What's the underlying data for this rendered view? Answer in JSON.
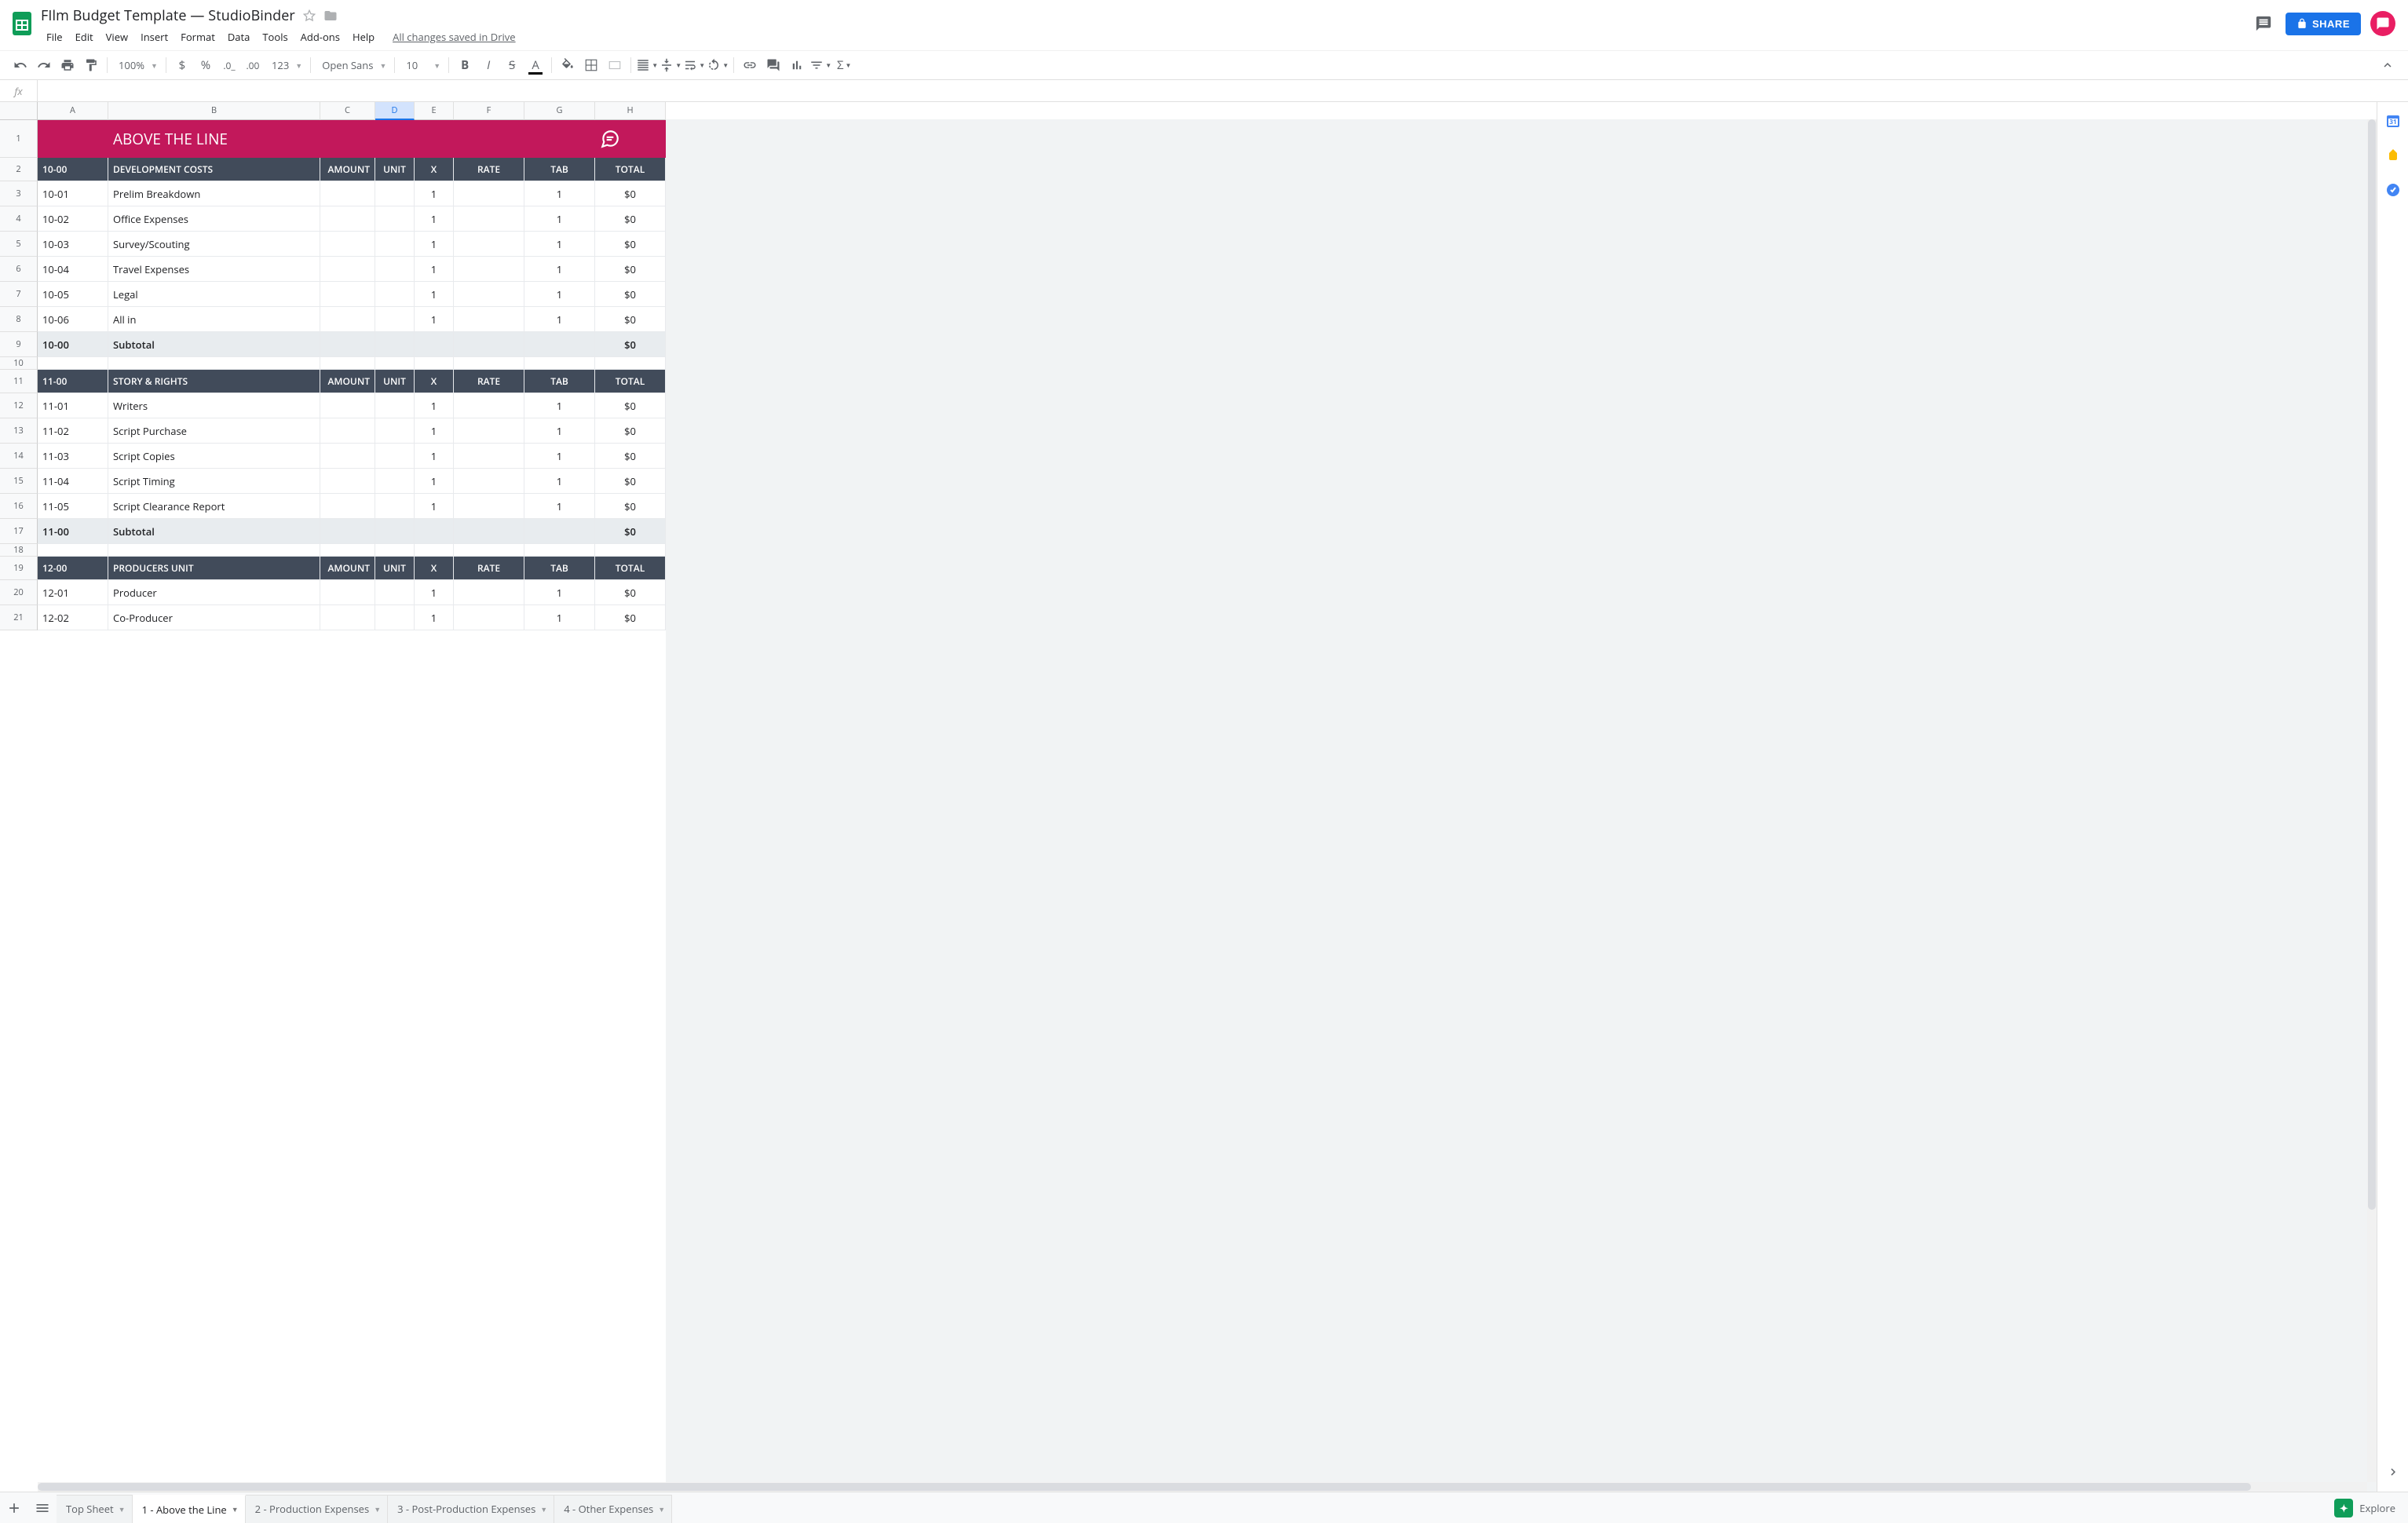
{
  "header": {
    "title": "FIlm Budget Template — StudioBinder",
    "menus": [
      "File",
      "Edit",
      "View",
      "Insert",
      "Format",
      "Data",
      "Tools",
      "Add-ons",
      "Help"
    ],
    "save_status": "All changes saved in Drive",
    "share_label": "SHARE"
  },
  "toolbar": {
    "zoom": "100%",
    "format_num": "123",
    "font": "Open Sans",
    "font_size": "10"
  },
  "formula": "",
  "columns": [
    "A",
    "B",
    "C",
    "D",
    "E",
    "F",
    "G",
    "H"
  ],
  "selected_col": "D",
  "rows": [
    {
      "n": 1,
      "type": "title",
      "cells": {
        "b": "ABOVE THE LINE",
        "h_icon": true
      }
    },
    {
      "n": 2,
      "type": "header",
      "cells": {
        "a": "10-00",
        "b": "DEVELOPMENT COSTS",
        "c": "AMOUNT",
        "d": "UNIT",
        "e": "X",
        "f": "RATE",
        "g": "TAB",
        "h": "TOTAL"
      }
    },
    {
      "n": 3,
      "type": "data",
      "cells": {
        "a": "10-01",
        "b": "Prelim Breakdown",
        "e": "1",
        "g": "1",
        "h": "$0"
      }
    },
    {
      "n": 4,
      "type": "data",
      "cells": {
        "a": "10-02",
        "b": "Office Expenses",
        "e": "1",
        "g": "1",
        "h": "$0"
      }
    },
    {
      "n": 5,
      "type": "data",
      "cells": {
        "a": "10-03",
        "b": "Survey/Scouting",
        "e": "1",
        "g": "1",
        "h": "$0"
      }
    },
    {
      "n": 6,
      "type": "data",
      "cells": {
        "a": "10-04",
        "b": "Travel Expenses",
        "e": "1",
        "g": "1",
        "h": "$0"
      }
    },
    {
      "n": 7,
      "type": "data",
      "cells": {
        "a": "10-05",
        "b": "Legal",
        "e": "1",
        "g": "1",
        "h": "$0"
      }
    },
    {
      "n": 8,
      "type": "data",
      "cells": {
        "a": "10-06",
        "b": "All in",
        "e": "1",
        "g": "1",
        "h": "$0"
      }
    },
    {
      "n": 9,
      "type": "sub",
      "cells": {
        "a": "10-00",
        "b": "Subtotal",
        "h": "$0"
      }
    },
    {
      "n": 10,
      "type": "empty",
      "cells": {}
    },
    {
      "n": 11,
      "type": "header",
      "cells": {
        "a": "11-00",
        "b": "STORY & RIGHTS",
        "c": "AMOUNT",
        "d": "UNIT",
        "e": "X",
        "f": "RATE",
        "g": "TAB",
        "h": "TOTAL"
      }
    },
    {
      "n": 12,
      "type": "data",
      "cells": {
        "a": "11-01",
        "b": "Writers",
        "e": "1",
        "g": "1",
        "h": "$0"
      }
    },
    {
      "n": 13,
      "type": "data",
      "cells": {
        "a": "11-02",
        "b": "Script Purchase",
        "e": "1",
        "g": "1",
        "h": "$0"
      }
    },
    {
      "n": 14,
      "type": "data",
      "cells": {
        "a": "11-03",
        "b": "Script Copies",
        "e": "1",
        "g": "1",
        "h": "$0"
      }
    },
    {
      "n": 15,
      "type": "data",
      "cells": {
        "a": "11-04",
        "b": "Script Timing",
        "e": "1",
        "g": "1",
        "h": "$0"
      }
    },
    {
      "n": 16,
      "type": "data",
      "cells": {
        "a": "11-05",
        "b": "Script Clearance Report",
        "e": "1",
        "g": "1",
        "h": "$0"
      }
    },
    {
      "n": 17,
      "type": "sub",
      "cells": {
        "a": "11-00",
        "b": "Subtotal",
        "h": "$0"
      }
    },
    {
      "n": 18,
      "type": "empty",
      "cells": {}
    },
    {
      "n": 19,
      "type": "header",
      "cells": {
        "a": "12-00",
        "b": "PRODUCERS UNIT",
        "c": "AMOUNT",
        "d": "UNIT",
        "e": "X",
        "f": "RATE",
        "g": "TAB",
        "h": "TOTAL"
      }
    },
    {
      "n": 20,
      "type": "data",
      "cells": {
        "a": "12-01",
        "b": "Producer",
        "e": "1",
        "g": "1",
        "h": "$0"
      }
    },
    {
      "n": 21,
      "type": "data",
      "cells": {
        "a": "12-02",
        "b": "Co-Producer",
        "e": "1",
        "g": "1",
        "h": "$0"
      }
    }
  ],
  "tabs": [
    {
      "label": "Top Sheet",
      "active": false
    },
    {
      "label": "1 - Above the Line",
      "active": true
    },
    {
      "label": "2 - Production Expenses",
      "active": false
    },
    {
      "label": "3 - Post-Production Expenses",
      "active": false
    },
    {
      "label": "4 - Other Expenses",
      "active": false
    }
  ],
  "explore_label": "Explore"
}
